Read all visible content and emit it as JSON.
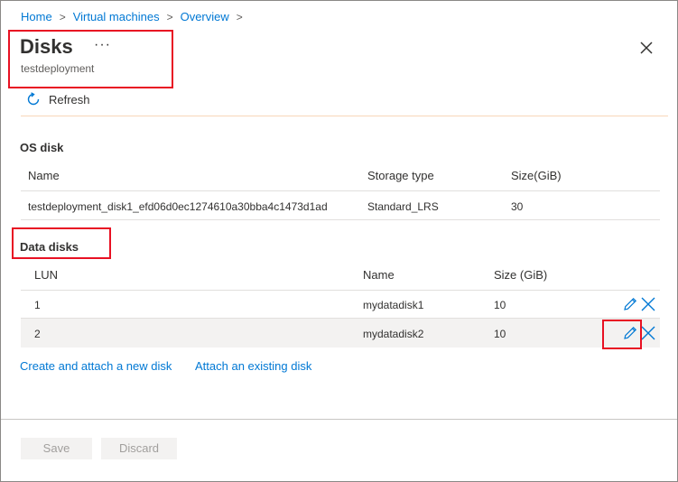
{
  "breadcrumb": [
    "Home",
    "Virtual machines",
    "Overview"
  ],
  "header": {
    "title": "Disks",
    "more": "···",
    "subtitle": "testdeployment"
  },
  "toolbar": {
    "refresh_label": "Refresh"
  },
  "os_disk": {
    "heading": "OS disk",
    "columns": [
      "Name",
      "Storage type",
      "Size(GiB)"
    ],
    "row": {
      "name": "testdeployment_disk1_efd06d0ec1274610a30bba4c1473d1ad",
      "storage_type": "Standard_LRS",
      "size": "30"
    }
  },
  "data_disks": {
    "heading": "Data disks",
    "columns": [
      "LUN",
      "Name",
      "Size (GiB)"
    ],
    "rows": [
      {
        "lun": "1",
        "name": "mydatadisk1",
        "size": "10"
      },
      {
        "lun": "2",
        "name": "mydatadisk2",
        "size": "10"
      }
    ]
  },
  "links": {
    "create_attach": "Create and attach a new disk",
    "attach_existing": "Attach an existing disk"
  },
  "footer": {
    "save_label": "Save",
    "discard_label": "Discard"
  },
  "colors": {
    "accent": "#0078d4",
    "highlight": "#e81123"
  }
}
